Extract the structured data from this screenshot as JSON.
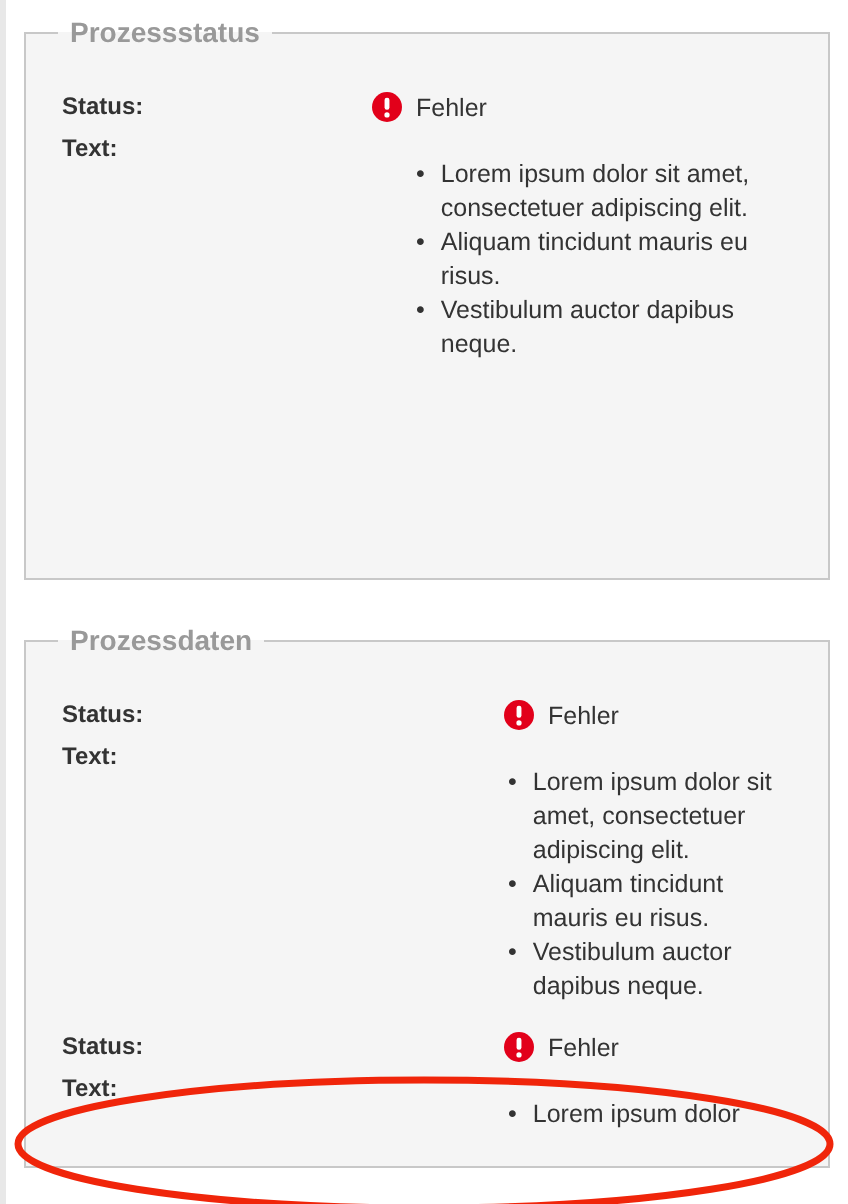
{
  "sections": [
    {
      "title": "Prozessstatus",
      "entries": [
        {
          "status_label": "Status:",
          "status": {
            "kind": "error",
            "text": "Fehler"
          },
          "text_label": "Text:",
          "items": [
            {
              "marker": "•",
              "text": "Lorem ipsum dolor sit amet, consectetuer adipiscing elit."
            },
            {
              "marker": "•",
              "text": "Aliquam tincidunt mauris eu risus."
            },
            {
              "marker": "•",
              "text": "Vestibulum auctor dapibus neque."
            }
          ]
        }
      ]
    },
    {
      "title": "Prozessdaten",
      "entries": [
        {
          "status_label": "Status:",
          "status": {
            "kind": "error",
            "text": "Fehler"
          },
          "text_label": "Text:",
          "items": [
            {
              "marker": "•",
              "text": "Lorem ipsum dolor sit amet, consectetuer adipiscing elit."
            },
            {
              "marker": "•",
              "text": "Aliquam tincidunt mauris eu risus."
            },
            {
              "marker": "•",
              "text": "Vestibulum auctor dapibus neque."
            }
          ]
        },
        {
          "status_label": "Status:",
          "status": {
            "kind": "error",
            "text": "Fehler"
          },
          "text_label": "Text:",
          "items": [
            {
              "marker": "•",
              "text": "Lorem ipsum dolor"
            }
          ]
        }
      ]
    }
  ],
  "annotations": [
    {
      "kind": "ellipse"
    }
  ]
}
